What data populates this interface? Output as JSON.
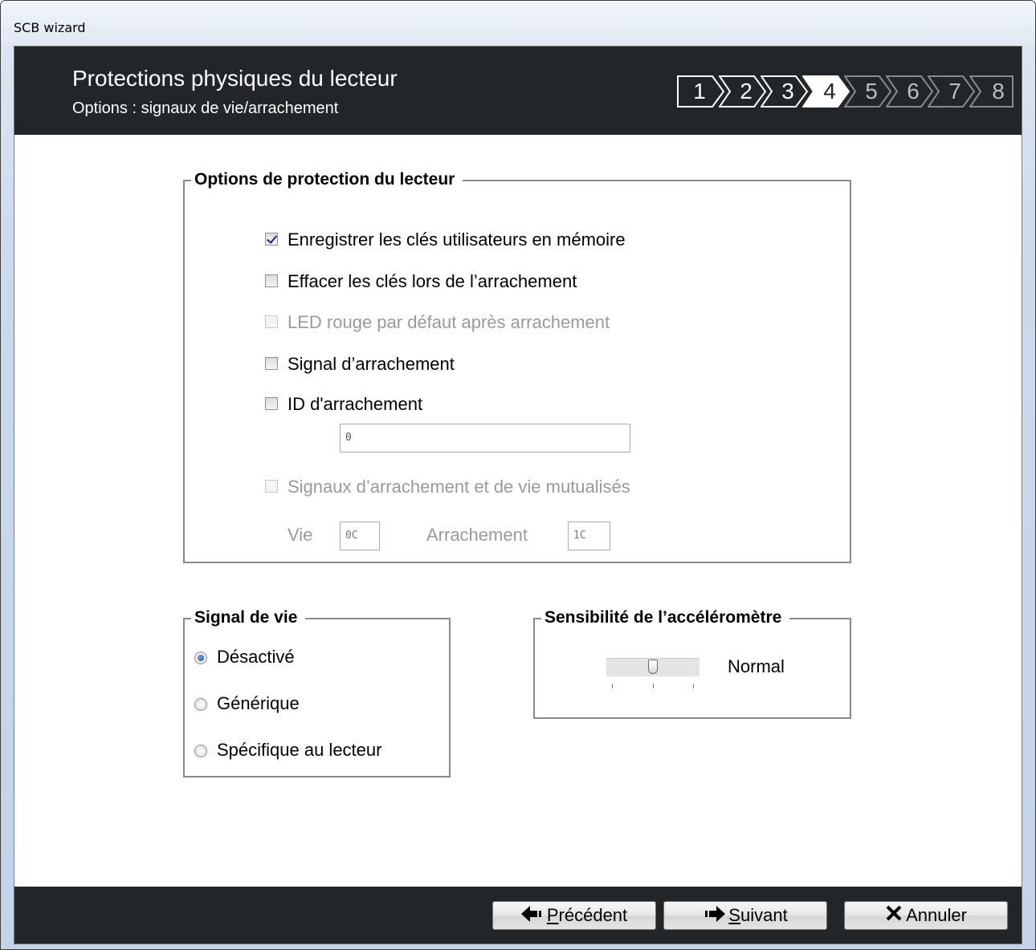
{
  "window": {
    "title": "SCB wizard"
  },
  "header": {
    "title": "Protections physiques du lecteur",
    "subtitle": "Options : signaux de vie/arrachement"
  },
  "steps": {
    "items": [
      "1",
      "2",
      "3",
      "4",
      "5",
      "6",
      "7",
      "8"
    ],
    "active": "4"
  },
  "protection_group": {
    "legend": "Options de protection du lecteur",
    "options": [
      {
        "label": "Enregistrer les clés utilisateurs en mémoire",
        "checked": true,
        "enabled": true
      },
      {
        "label": "Effacer les clés lors de l’arrachement",
        "checked": false,
        "enabled": true
      },
      {
        "label": "LED rouge par défaut après arrachement",
        "checked": false,
        "enabled": false
      },
      {
        "label": "Signal d’arrachement",
        "checked": false,
        "enabled": true
      },
      {
        "label": "ID d'arrachement",
        "checked": false,
        "enabled": true
      },
      {
        "label": "Signaux d’arrachement et de vie mutualisés",
        "checked": false,
        "enabled": false
      }
    ],
    "id_value": "0",
    "vie_label": "Vie",
    "vie_value": "0C",
    "arrachement_label": "Arrachement",
    "arrachement_value": "1C"
  },
  "signal_group": {
    "legend": "Signal de vie",
    "options": [
      {
        "label": "Désactivé",
        "selected": true
      },
      {
        "label": "Générique",
        "selected": false
      },
      {
        "label": "Spécifique au lecteur",
        "selected": false
      }
    ]
  },
  "accel_group": {
    "legend": "Sensibilité de l’accéléromètre",
    "value_label": "Normal",
    "slider_level": 0.5
  },
  "footer": {
    "previous_prefix": "",
    "previous_mnemonic": "P",
    "previous_rest": "récédent",
    "next_mnemonic": "S",
    "next_rest": "uivant",
    "cancel_label": "Annuler"
  }
}
